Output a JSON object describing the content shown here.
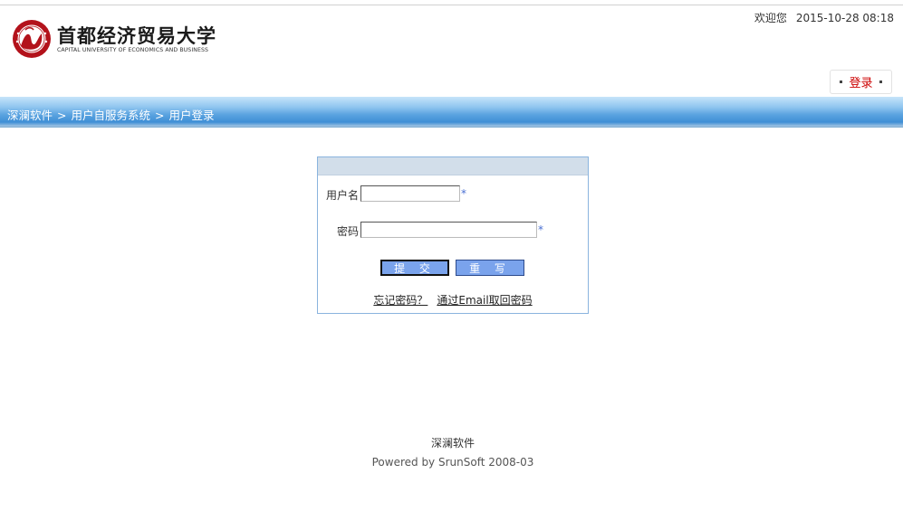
{
  "header": {
    "logo_cn": "首都经济贸易大学",
    "logo_en": "CAPITAL UNIVERSITY OF ECONOMICS AND BUSINESS",
    "welcome": "欢迎您",
    "datetime": "2015-10-28 08:18",
    "login_tab": "登录"
  },
  "breadcrumb": {
    "items": [
      "深澜软件",
      "用户自服务系统",
      "用户登录"
    ],
    "separator": ">"
  },
  "login_form": {
    "username_label": "用户名",
    "username_value": "",
    "password_label": "密码",
    "password_value": "",
    "required_mark": "*",
    "submit_label": "提 交",
    "reset_label": "重 写",
    "forgot_link": "忘记密码？",
    "email_link": "通过Email取回密码"
  },
  "footer": {
    "company": "深澜软件",
    "powered_by": "Powered by SrunSoft 2008-03"
  },
  "colors": {
    "accent_blue": "#5aa3e0",
    "button_blue": "#7aa3ec",
    "login_red": "#cc0000",
    "logo_red": "#b3121b"
  },
  "icons": {
    "logo": "university-emblem-icon"
  }
}
